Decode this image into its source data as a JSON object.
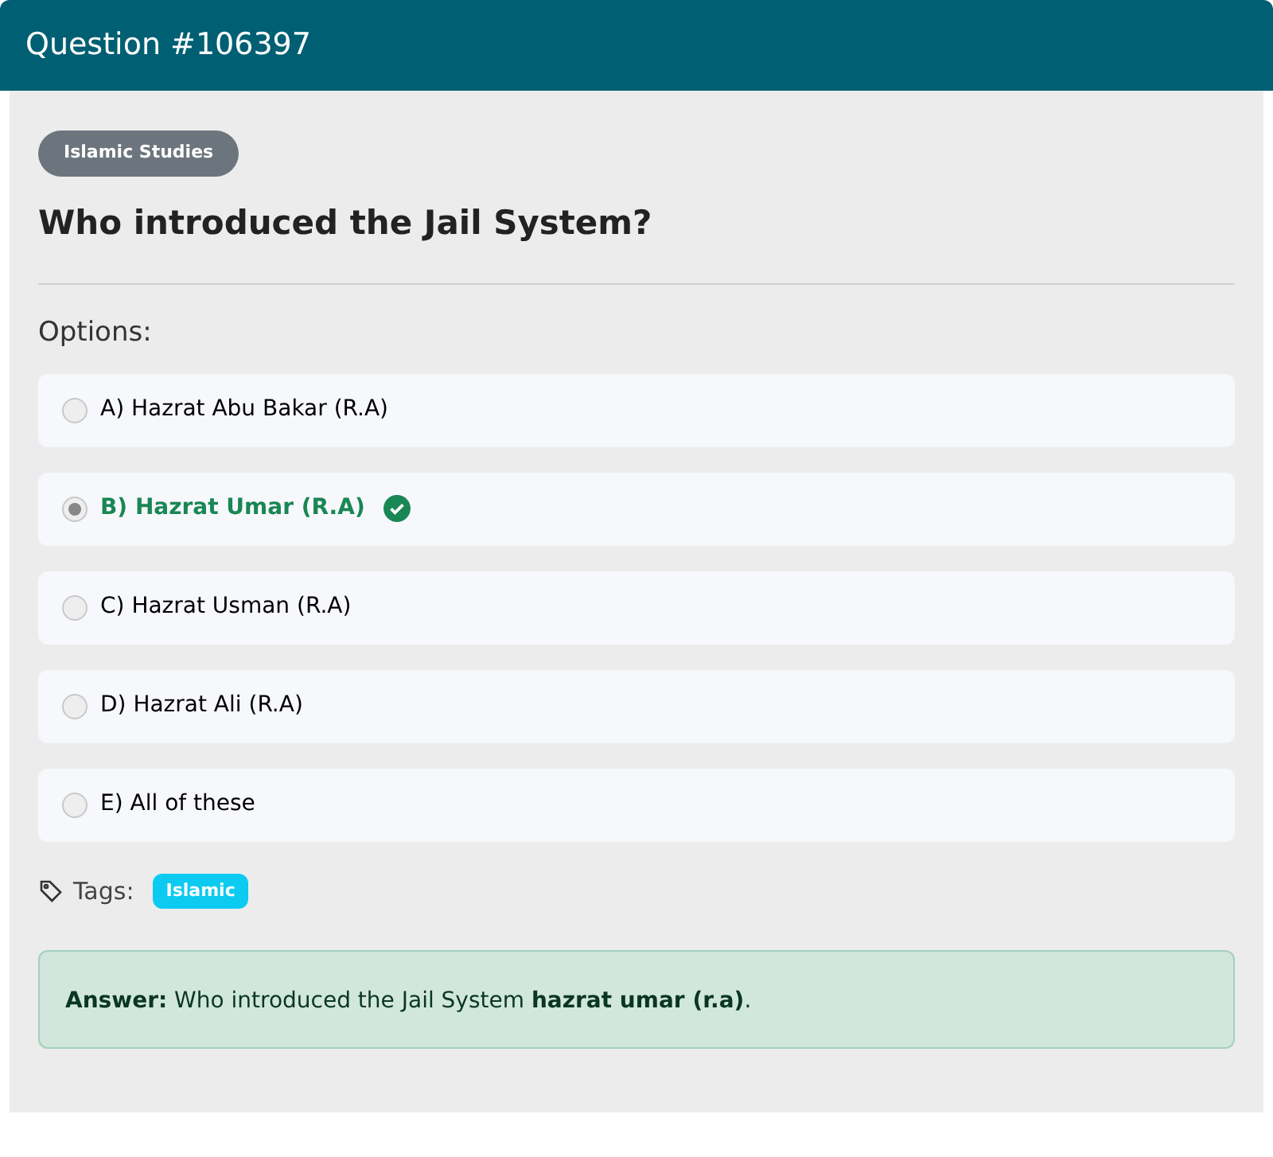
{
  "header": {
    "title": "Question #106397"
  },
  "category": "Islamic Studies",
  "question": "Who introduced the Jail System?",
  "options_label": "Options:",
  "options": [
    {
      "label": "A) Hazrat Abu Bakar (R.A)",
      "selected": false,
      "correct": false
    },
    {
      "label": "B) Hazrat Umar (R.A)",
      "selected": true,
      "correct": true
    },
    {
      "label": "C) Hazrat Usman (R.A)",
      "selected": false,
      "correct": false
    },
    {
      "label": "D) Hazrat Ali (R.A)",
      "selected": false,
      "correct": false
    },
    {
      "label": "E) All of these",
      "selected": false,
      "correct": false
    }
  ],
  "tags_label": "Tags:",
  "tags": [
    "Islamic"
  ],
  "answer": "**Answer:** Who introduced the Jail System **hazrat umar (r.a)**."
}
